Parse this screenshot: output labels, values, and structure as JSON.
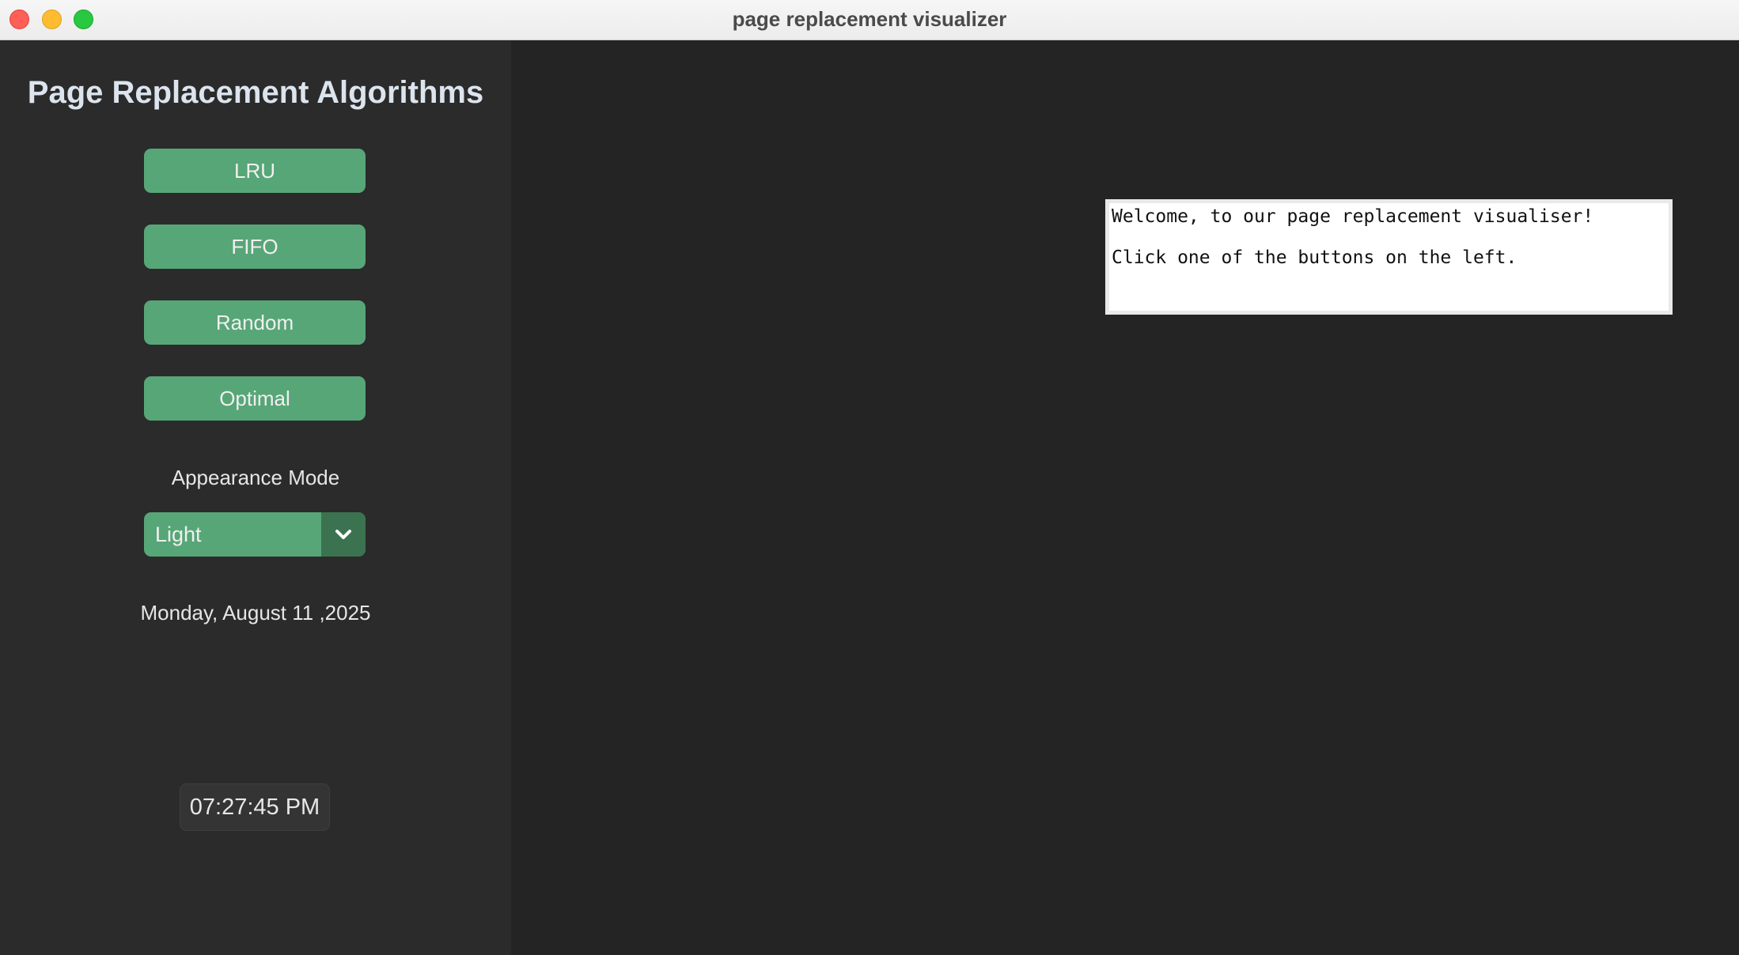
{
  "window": {
    "title": "page replacement visualizer"
  },
  "sidebar": {
    "title": "Page Replacement Algorithms",
    "buttons": [
      {
        "label": "LRU"
      },
      {
        "label": "FIFO"
      },
      {
        "label": "Random"
      },
      {
        "label": "Optimal"
      }
    ],
    "appearance_label": "Appearance Mode",
    "appearance_value": "Light",
    "date": "Monday, August 11 ,2025",
    "time": "07:27:45 PM"
  },
  "main": {
    "welcome_lines": [
      "Welcome, to our page replacement visualiser!",
      "Click one of the buttons on the left."
    ]
  },
  "colors": {
    "accent": "#57a677",
    "accent_dark": "#3b7350",
    "sidebar_bg": "#2b2b2b",
    "main_bg": "#242424"
  },
  "icons": {
    "dropdown": "chevron-down-icon"
  }
}
